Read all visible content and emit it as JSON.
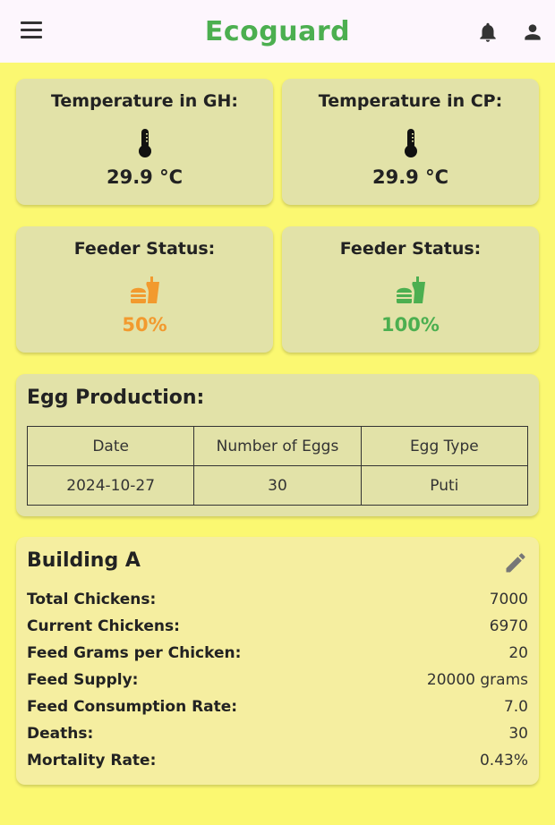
{
  "appbar": {
    "title": "Ecoguard",
    "title_color": "#4caf50",
    "icons": [
      "menu-icon",
      "bell-icon",
      "person-icon"
    ]
  },
  "temperature_cards": [
    {
      "label": "Temperature in GH:",
      "value": "29.9 °C",
      "icon": "thermometer-icon"
    },
    {
      "label": "Temperature in CP:",
      "value": "29.9 °C",
      "icon": "thermometer-icon"
    }
  ],
  "feeder_cards": [
    {
      "label": "Feeder Status:",
      "value": "50%",
      "icon": "fastfood-icon",
      "color": "#f29a2e"
    },
    {
      "label": "Feeder Status:",
      "value": "100%",
      "icon": "fastfood-icon",
      "color": "#4caf50"
    }
  ],
  "egg_production": {
    "title": "Egg Production:",
    "columns": [
      "Date",
      "Number of Eggs",
      "Egg Type"
    ],
    "rows": [
      [
        "2024-10-27",
        "30",
        "Puti"
      ]
    ]
  },
  "building": {
    "title": "Building A",
    "edit_icon": "edit-icon",
    "rows": [
      {
        "label": "Total Chickens:",
        "value": "7000"
      },
      {
        "label": "Current Chickens:",
        "value": "6970"
      },
      {
        "label": "Feed Grams per Chicken:",
        "value": "20"
      },
      {
        "label": "Feed Supply:",
        "value": "20000 grams"
      },
      {
        "label": "Feed Consumption Rate:",
        "value": "7.0"
      },
      {
        "label": "Deaths:",
        "value": "30"
      },
      {
        "label": "Mortality Rate:",
        "value": "0.43%"
      }
    ]
  },
  "colors": {
    "background": "#fbf871",
    "appbar": "#fdf6fd",
    "card": "#e2e2a8",
    "building_card": "#f5eea0"
  }
}
